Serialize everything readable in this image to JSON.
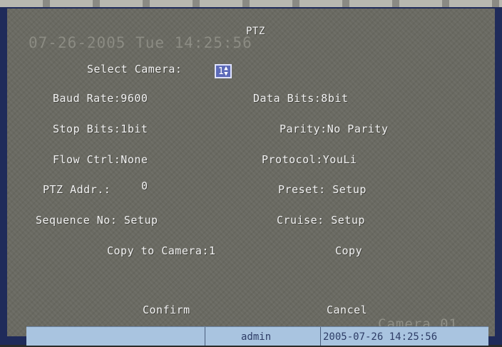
{
  "osd": {
    "datetime": "07-26-2005 Tue 14:25:56",
    "camera": "Camera 01"
  },
  "title": "PTZ",
  "select_camera": {
    "label": "Select Camera:",
    "value": "1"
  },
  "fields": {
    "baud_rate": "Baud Rate:9600",
    "data_bits": "Data Bits:8bit",
    "stop_bits": "Stop Bits:1bit",
    "parity": "Parity:No Parity",
    "flow_ctrl": "Flow Ctrl:None",
    "protocol": "Protocol:YouLi",
    "ptz_addr_label": "PTZ Addr.:",
    "ptz_addr_value": "0",
    "preset": "Preset: Setup",
    "sequence": "Sequence No: Setup",
    "cruise": "Cruise: Setup",
    "copy_to_camera": "Copy to Camera:1",
    "copy": "Copy"
  },
  "buttons": {
    "confirm": "Confirm",
    "cancel": "Cancel"
  },
  "statusbar": {
    "user": "admin",
    "datetime": "2005-07-26 14:25:56"
  }
}
